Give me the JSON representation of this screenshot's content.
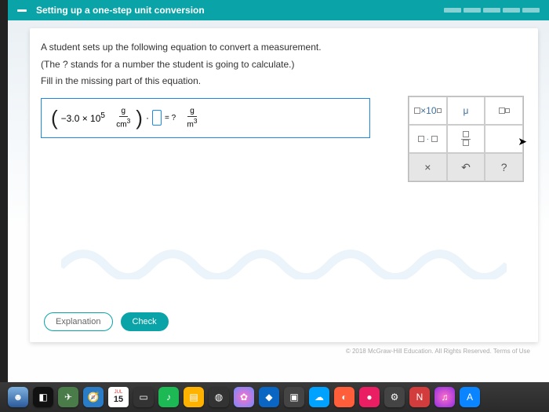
{
  "header": {
    "title": "Setting up a one-step unit conversion"
  },
  "problem": {
    "line1": "A student sets up the following equation to convert a measurement.",
    "line2": "(The ? stands for a number the student is going to calculate.)",
    "line3": "Fill in the missing part of this equation."
  },
  "equation": {
    "lhs_coeff": "−3.0 × 10",
    "lhs_exp": "5",
    "lhs_unit_num": "g",
    "lhs_unit_den_base": "cm",
    "lhs_unit_den_exp": "3",
    "equals": "= ?",
    "rhs_unit_num": "g",
    "rhs_unit_den_base": "m",
    "rhs_unit_den_exp": "3"
  },
  "keypad": {
    "ten_power": "×10",
    "mu": "μ",
    "dot": "·",
    "clear": "×",
    "undo": "↶",
    "help": "?"
  },
  "buttons": {
    "explanation": "Explanation",
    "check": "Check"
  },
  "footer": {
    "copyright": "© 2018 McGraw-Hill Education. All Rights Reserved.  Terms of Use"
  },
  "dock": {
    "calendar_day": "15"
  }
}
